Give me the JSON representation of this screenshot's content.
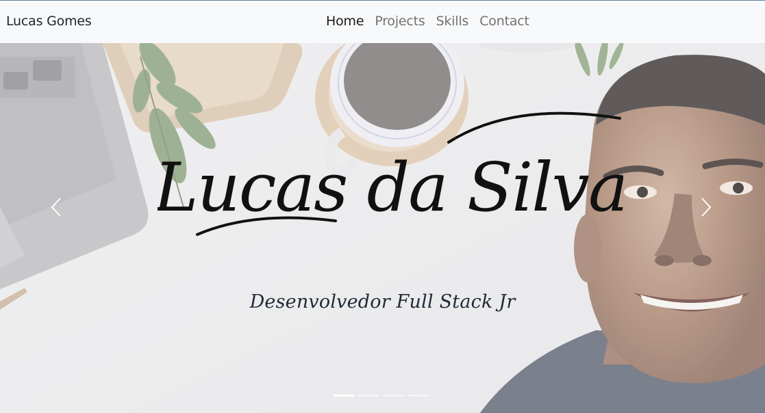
{
  "navbar": {
    "brand": "Lucas Gomes",
    "links": [
      {
        "label": "Home",
        "active": true
      },
      {
        "label": "Projects",
        "active": false
      },
      {
        "label": "Skills",
        "active": false
      },
      {
        "label": "Contact",
        "active": false
      }
    ]
  },
  "hero": {
    "title": "Lucas da Silva",
    "subtitle": "Desenvolvedor Full Stack Jr",
    "prev_icon": "chevron-left-icon",
    "next_icon": "chevron-right-icon",
    "slide_count": 4,
    "active_slide": 1
  },
  "colors": {
    "navbar_bg": "#f8f9fa",
    "text_dark": "#212529",
    "title_ink": "#111111",
    "subtitle": "#1f2a36"
  }
}
